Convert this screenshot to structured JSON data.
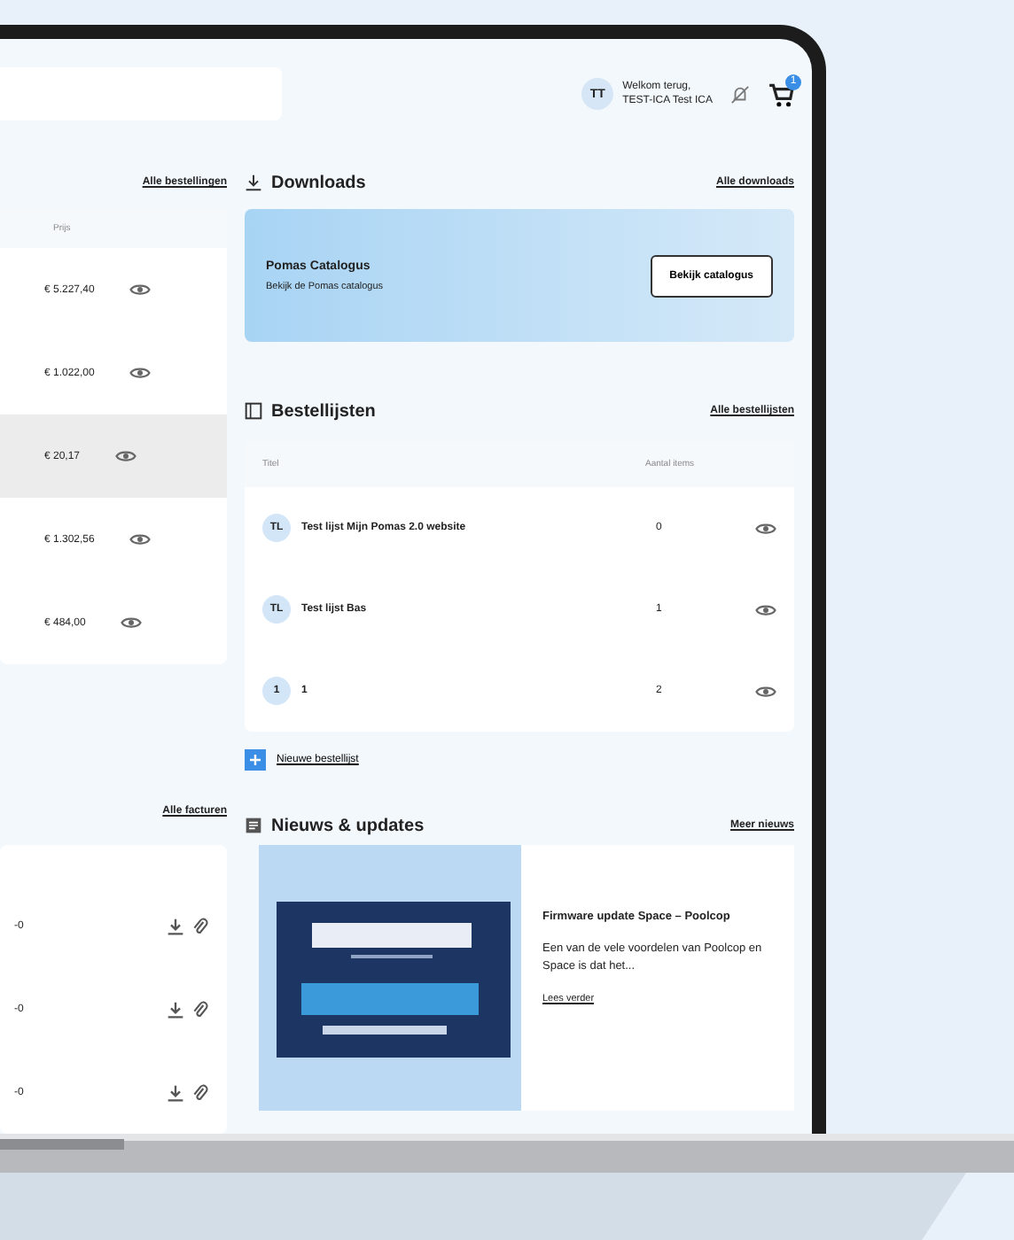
{
  "header": {
    "user": {
      "initials": "TT",
      "greeting": "Welkom terug,",
      "name": "TEST-ICA Test ICA"
    },
    "cart_count": "1"
  },
  "orders": {
    "link": "Alle bestellingen",
    "column": "Prijs",
    "rows": [
      {
        "price": "€ 5.227,40",
        "selected": false
      },
      {
        "price": "€ 1.022,00",
        "selected": false
      },
      {
        "price": "€ 20,17",
        "selected": true
      },
      {
        "price": "€ 1.302,56",
        "selected": false
      },
      {
        "price": "€ 484,00",
        "selected": false
      }
    ]
  },
  "invoices": {
    "link": "Alle facturen",
    "rows": [
      {
        "ref": "-0"
      },
      {
        "ref": "-0"
      },
      {
        "ref": "-0"
      }
    ]
  },
  "downloads": {
    "title": "Downloads",
    "link": "Alle downloads",
    "card": {
      "title": "Pomas Catalogus",
      "text": "Bekijk de Pomas catalogus",
      "button": "Bekijk catalogus"
    }
  },
  "order_lists": {
    "title": "Bestellijsten",
    "link": "Alle bestellijsten",
    "columns": [
      "Titel",
      "Aantal items"
    ],
    "rows": [
      {
        "initials": "TL",
        "title": "Test lijst Mijn Pomas 2.0 website",
        "count": "0"
      },
      {
        "initials": "TL",
        "title": "Test lijst Bas",
        "count": "1"
      },
      {
        "initials": "1",
        "title": "1",
        "count": "2"
      }
    ],
    "new_button": "Nieuwe bestellijst"
  },
  "news": {
    "title": "Nieuws & updates",
    "link": "Meer nieuws",
    "items": [
      {
        "kind": "picture",
        "headline": "Firmware update Space – Poolcop",
        "excerpt": "Een van de vele voordelen van Poolcop en Space is dat het...",
        "link": "Lees verder"
      }
    ]
  }
}
